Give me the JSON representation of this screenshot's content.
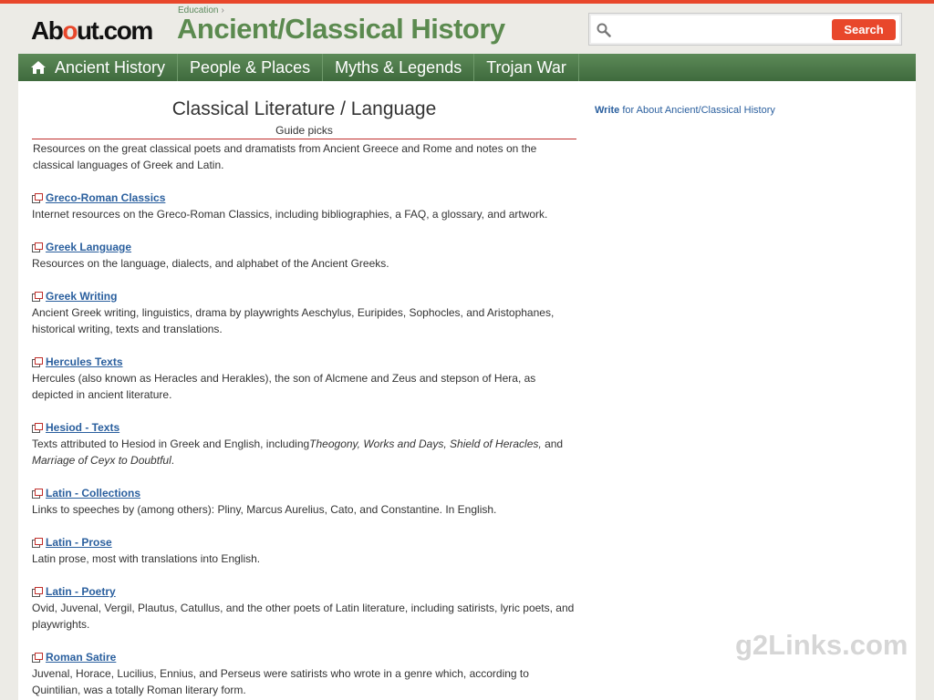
{
  "header": {
    "logo_prefix": "Ab",
    "logo_dot": "o",
    "logo_suffix": "ut.com",
    "breadcrumb": "Education",
    "site_title": "Ancient/Classical History",
    "search_placeholder": "",
    "search_button": "Search"
  },
  "nav": {
    "items": [
      {
        "label": "Ancient History"
      },
      {
        "label": "People & Places"
      },
      {
        "label": "Myths & Legends"
      },
      {
        "label": "Trojan War"
      }
    ]
  },
  "main": {
    "title": "Classical Literature / Language",
    "subtitle": "Guide picks",
    "intro": "Resources on the great classical poets and dramatists from Ancient Greece and Rome and notes on the classical languages of Greek and Latin.",
    "links": [
      {
        "title": "Greco-Roman Classics",
        "desc": "Internet resources on the Greco-Roman Classics, including bibliographies, a FAQ, a glossary, and artwork."
      },
      {
        "title": "Greek Language",
        "desc": "Resources on the language, dialects, and alphabet of the Ancient Greeks."
      },
      {
        "title": "Greek Writing",
        "desc": "Ancient Greek writing, linguistics, drama by playwrights Aeschylus, Euripides, Sophocles, and Aristophanes, historical writing, texts and translations."
      },
      {
        "title": "Hercules Texts",
        "desc": "Hercules (also known as Heracles and Herakles), the son of Alcmene and Zeus and stepson of Hera, as depicted in ancient literature."
      },
      {
        "title": "Hesiod - Texts",
        "desc_pre": "Texts attributed to Hesiod in Greek and English, including",
        "desc_italic_1": "Theogony, Works and Days, Shield of Heracles,",
        "desc_mid": " and ",
        "desc_italic_2": "Marriage of Ceyx to Doubtful",
        "desc_post": "."
      },
      {
        "title": "Latin - Collections",
        "desc": "Links to speeches by (among others): Pliny, Marcus Aurelius, Cato, and Constantine. In English."
      },
      {
        "title": "Latin - Prose",
        "desc": "Latin prose, most with translations into English."
      },
      {
        "title": "Latin - Poetry",
        "desc": "Ovid, Juvenal, Vergil, Plautus, Catullus, and the other poets of Latin literature, including satirists, lyric poets, and playwrights."
      },
      {
        "title": "Roman Satire",
        "desc": "Juvenal, Horace, Lucilius, Ennius, and Perseus were satirists who wrote in a genre which, according to Quintilian, was a totally Roman literary form."
      }
    ]
  },
  "sidebar": {
    "write_bold": "Write",
    "write_rest": " for About Ancient/Classical History"
  },
  "watermark": "g2Links.com",
  "colors": {
    "accent": "#e8472b",
    "nav_green": "#4a7748",
    "title_green": "#5b8a4f",
    "link_blue": "#2a5f9e"
  }
}
